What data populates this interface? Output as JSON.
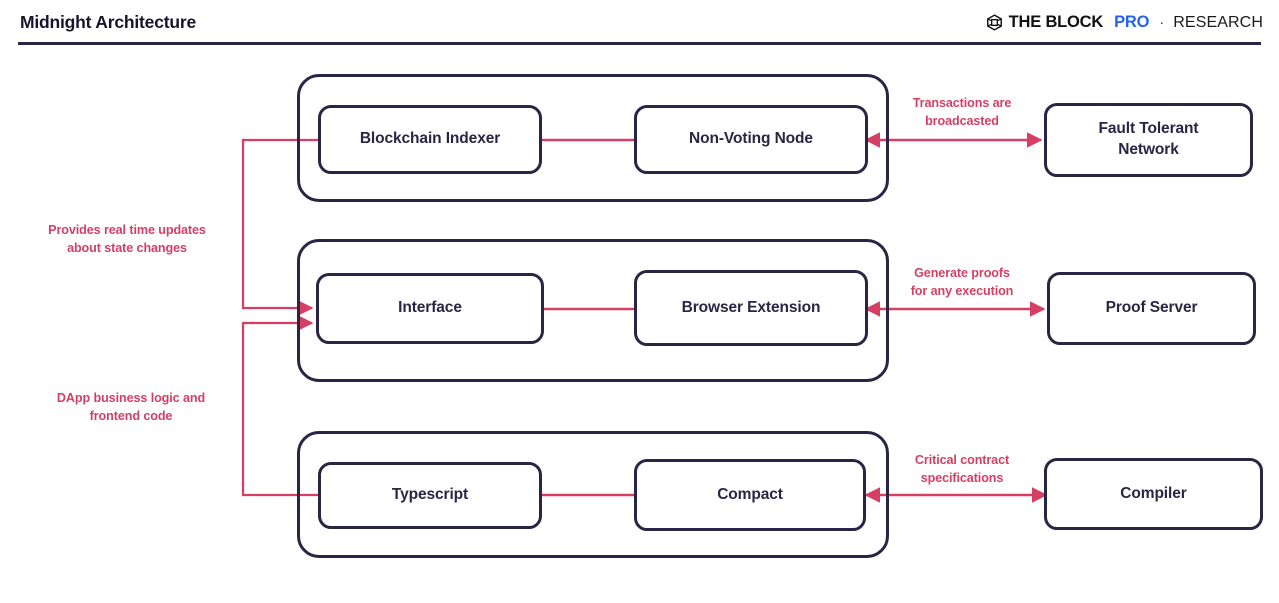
{
  "header": {
    "title": "Midnight Architecture",
    "brand": {
      "icon": "hexagon-cube-icon",
      "the_block": "THE BLOCK",
      "pro": "PRO",
      "separator": "·",
      "research": "RESEARCH"
    }
  },
  "colors": {
    "navy": "#2b2545",
    "crimson": "#d63f63",
    "blue_accent": "#2563eb",
    "background": "#ffffff"
  },
  "diagram": {
    "type": "architecture-block-diagram",
    "groups": [
      {
        "id": "group-node-layer",
        "nodes": [
          {
            "id": "blockchain-indexer",
            "label": "Blockchain Indexer"
          },
          {
            "id": "non-voting-node",
            "label": "Non-Voting Node"
          }
        ]
      },
      {
        "id": "group-client-layer",
        "nodes": [
          {
            "id": "interface",
            "label": "Interface"
          },
          {
            "id": "browser-extension",
            "label": "Browser Extension"
          }
        ]
      },
      {
        "id": "group-contract-layer",
        "nodes": [
          {
            "id": "typescript",
            "label": "Typescript"
          },
          {
            "id": "compact",
            "label": "Compact"
          }
        ]
      }
    ],
    "side_nodes": [
      {
        "id": "fault-tolerant-network",
        "label": "Fault Tolerant\nNetwork",
        "line1": "Fault Tolerant",
        "line2": "Network"
      },
      {
        "id": "proof-server",
        "label": "Proof Server",
        "line1": "Proof Server",
        "line2": ""
      },
      {
        "id": "compiler",
        "label": "Compiler",
        "line1": "Compiler",
        "line2": ""
      }
    ],
    "edge_labels": [
      {
        "id": "label-transactions-broadcasted",
        "line1": "Transactions are",
        "line2": "broadcasted",
        "side": "right"
      },
      {
        "id": "label-generate-proofs",
        "line1": "Generate proofs",
        "line2": "for any execution",
        "side": "right"
      },
      {
        "id": "label-critical-contract-specs",
        "line1": "Critical contract",
        "line2": "specifications",
        "side": "right"
      },
      {
        "id": "label-realtime-updates",
        "line1": "Provides real time updates",
        "line2": "about state changes",
        "side": "left"
      },
      {
        "id": "label-dapp-business-logic",
        "line1": "DApp business logic and",
        "line2": "frontend code",
        "side": "left"
      }
    ],
    "connections": [
      {
        "from": "group-node-layer",
        "to": "fault-tolerant-network",
        "arrow": "bidirectional",
        "label": "label-transactions-broadcasted"
      },
      {
        "from": "group-client-layer",
        "to": "proof-server",
        "arrow": "bidirectional",
        "label": "label-generate-proofs"
      },
      {
        "from": "group-contract-layer",
        "to": "compiler",
        "arrow": "bidirectional",
        "label": "label-critical-contract-specs"
      },
      {
        "from": "blockchain-indexer",
        "to": "interface",
        "arrow": "forward",
        "label": "label-realtime-updates"
      },
      {
        "from": "typescript",
        "to": "interface",
        "arrow": "forward",
        "label": "label-dapp-business-logic"
      },
      {
        "from": "blockchain-indexer",
        "to": "non-voting-node",
        "arrow": "none",
        "label": ""
      },
      {
        "from": "interface",
        "to": "browser-extension",
        "arrow": "none",
        "label": ""
      },
      {
        "from": "typescript",
        "to": "compact",
        "arrow": "none",
        "label": ""
      }
    ]
  }
}
